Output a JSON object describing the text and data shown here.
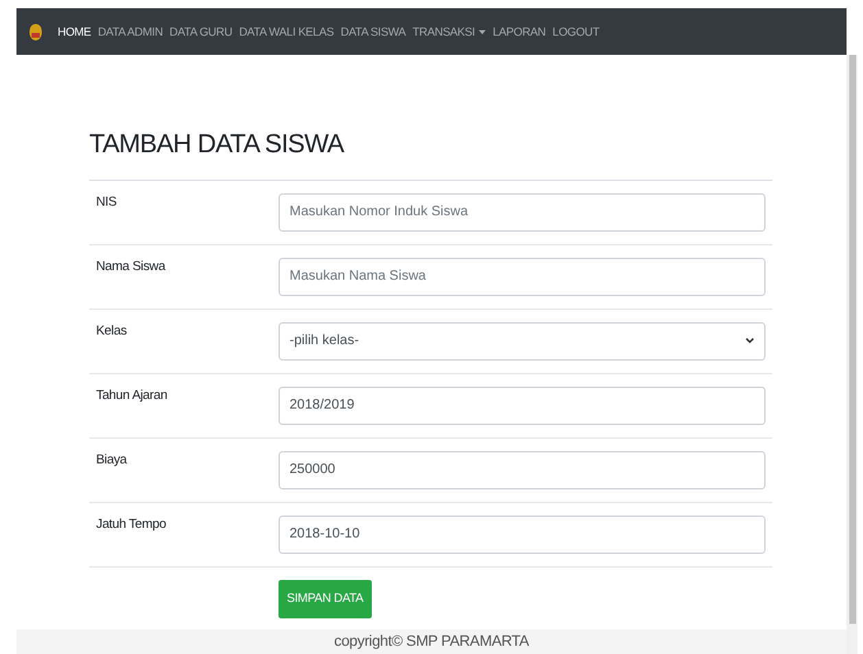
{
  "navbar": {
    "items": [
      {
        "label": "HOME",
        "selected": true,
        "dropdown": false
      },
      {
        "label": "DATA ADMIN",
        "selected": false,
        "dropdown": false
      },
      {
        "label": "DATA GURU",
        "selected": false,
        "dropdown": false
      },
      {
        "label": "DATA WALI KELAS",
        "selected": false,
        "dropdown": false
      },
      {
        "label": "DATA SISWA",
        "selected": false,
        "dropdown": false
      },
      {
        "label": "TRANSAKSI",
        "selected": false,
        "dropdown": true
      },
      {
        "label": "LAPORAN",
        "selected": false,
        "dropdown": false
      },
      {
        "label": "LOGOUT",
        "selected": false,
        "dropdown": false
      }
    ]
  },
  "form": {
    "title": "TAMBAH DATA SISWA",
    "fields": [
      {
        "label": "NIS",
        "kind": "text",
        "placeholder": "Masukan Nomor Induk Siswa"
      },
      {
        "label": "Nama Siswa",
        "kind": "text",
        "placeholder": "Masukan Nama Siswa"
      },
      {
        "label": "Kelas",
        "kind": "select",
        "value": "-pilih kelas-"
      },
      {
        "label": "Tahun Ajaran",
        "kind": "text",
        "value": "2018/2019"
      },
      {
        "label": "Biaya",
        "kind": "text",
        "value": "250000"
      },
      {
        "label": "Jatuh Tempo",
        "kind": "text",
        "value": "2018-10-10"
      }
    ],
    "submit": "SIMPAN DATA"
  },
  "footer": {
    "text": "copyright© SMP PARAMARTA"
  }
}
